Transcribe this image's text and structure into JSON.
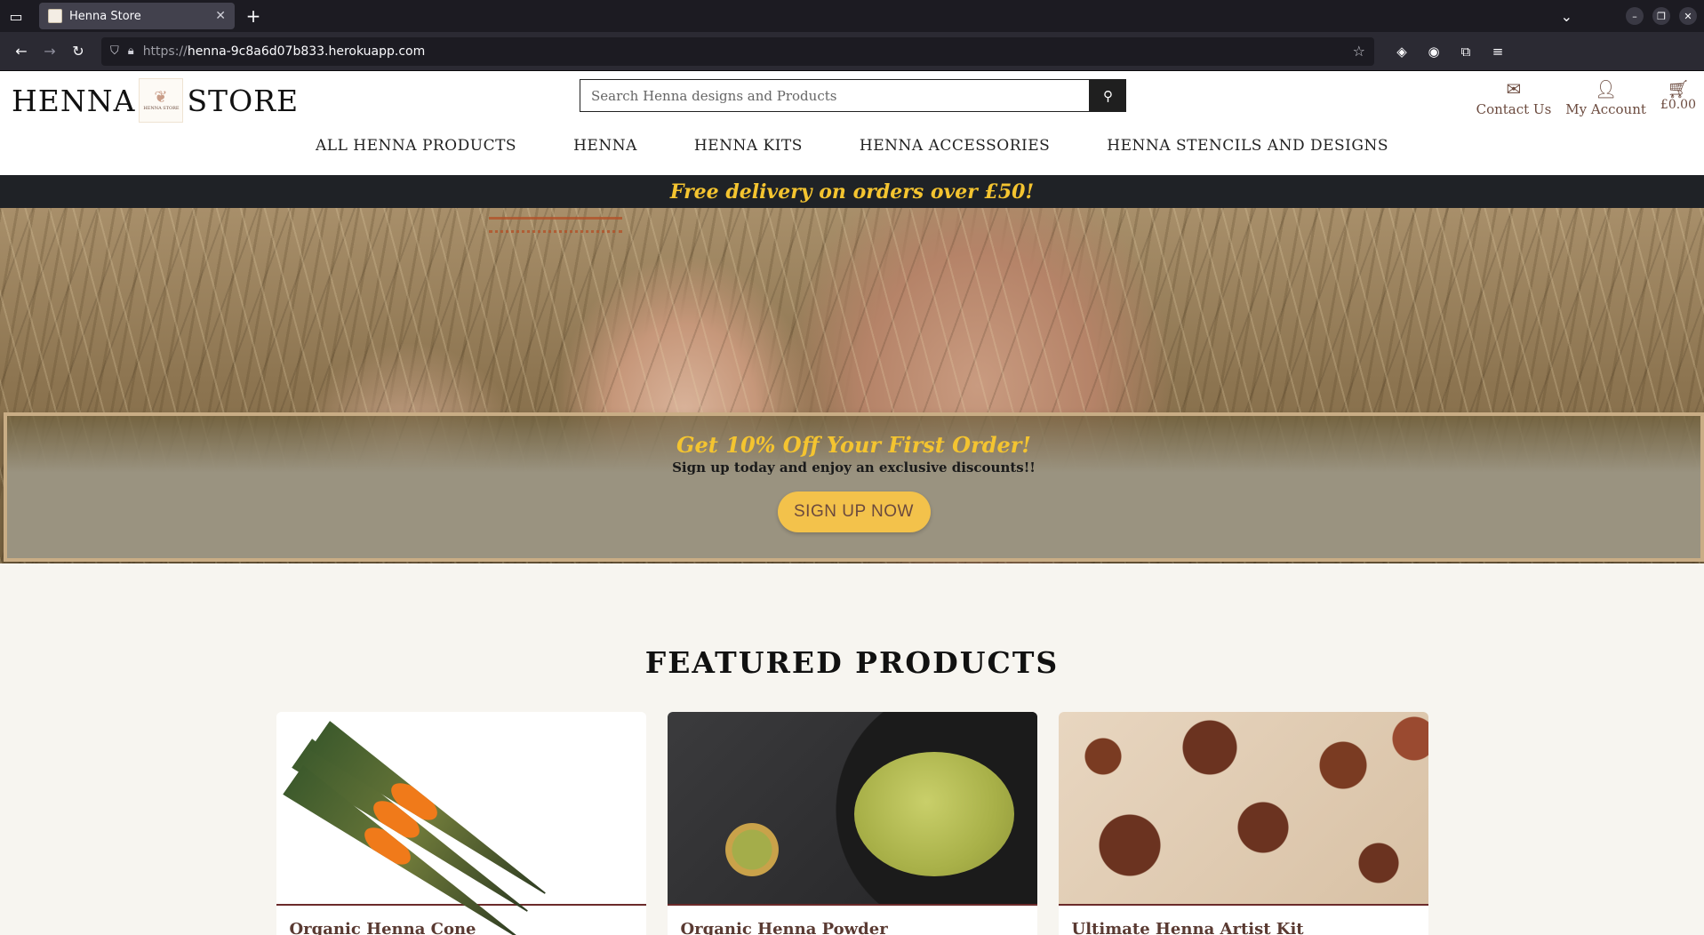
{
  "browser": {
    "tab_title": "Henna Store",
    "url_host": "henna-9c8a6d07b833.herokuapp.com",
    "url_proto": "https://"
  },
  "header": {
    "logo_left": "HENNA",
    "logo_right": "STORE",
    "logo_mark_text": "HENNA STORE",
    "search_placeholder": "Search Henna designs and Products",
    "contact_label": "Contact Us",
    "account_label": "My Account",
    "cart_total": "£0.00"
  },
  "nav": {
    "items": [
      {
        "label": "ALL HENNA PRODUCTS"
      },
      {
        "label": "HENNA"
      },
      {
        "label": "HENNA KITS"
      },
      {
        "label": "HENNA ACCESSORIES"
      },
      {
        "label": "HENNA STENCILS AND DESIGNS"
      }
    ]
  },
  "delivery_banner": "Free delivery on orders over £50!",
  "promo": {
    "heading": "Get 10% Off Your First Order!",
    "subtext": "Sign up today and enjoy an exclusive discounts!!",
    "cta": "SIGN UP NOW"
  },
  "featured": {
    "title": "FEATURED PRODUCTS",
    "products": [
      {
        "name": "Organic Henna Cone"
      },
      {
        "name": "Organic Henna Powder"
      },
      {
        "name": "Ultimate Henna Artist Kit"
      }
    ]
  },
  "colors": {
    "accent_gold": "#f4c430",
    "brand_brown": "#6b4a3e",
    "banner_dark": "#1f2226"
  }
}
